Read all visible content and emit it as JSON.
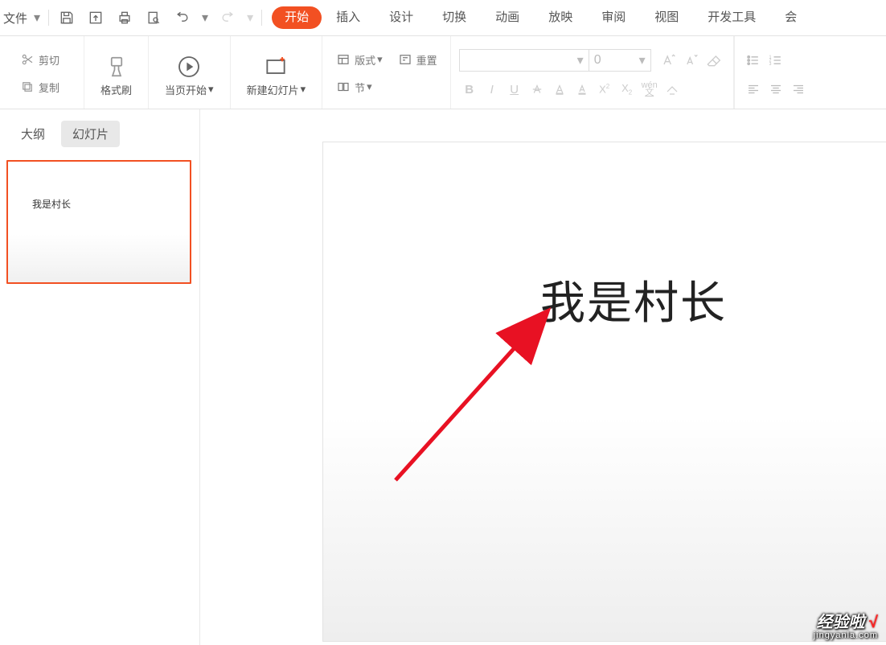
{
  "topbar": {
    "file_label": "文件"
  },
  "menu_tabs": [
    "开始",
    "插入",
    "设计",
    "切换",
    "动画",
    "放映",
    "审阅",
    "视图",
    "开发工具",
    "会"
  ],
  "menu_active_index": 0,
  "clipboard": {
    "cut": "剪切",
    "copy": "复制",
    "format_painter": "格式刷"
  },
  "slide_group": {
    "from_current": "当页开始",
    "new_slide": "新建幻灯片",
    "layout": "版式",
    "section": "节",
    "reset": "重置"
  },
  "font": {
    "name": "",
    "size": "0"
  },
  "left_tabs": {
    "outline": "大纲",
    "slides": "幻灯片"
  },
  "left_active": "slides",
  "thumbnail_text": "我是村长",
  "slide_content": {
    "title": "我是村长"
  },
  "watermark": {
    "line1": "经验啦",
    "check": "√",
    "line2": "jingyanla.com"
  },
  "icons": {
    "caret": "▾",
    "caret_small": "▾"
  }
}
